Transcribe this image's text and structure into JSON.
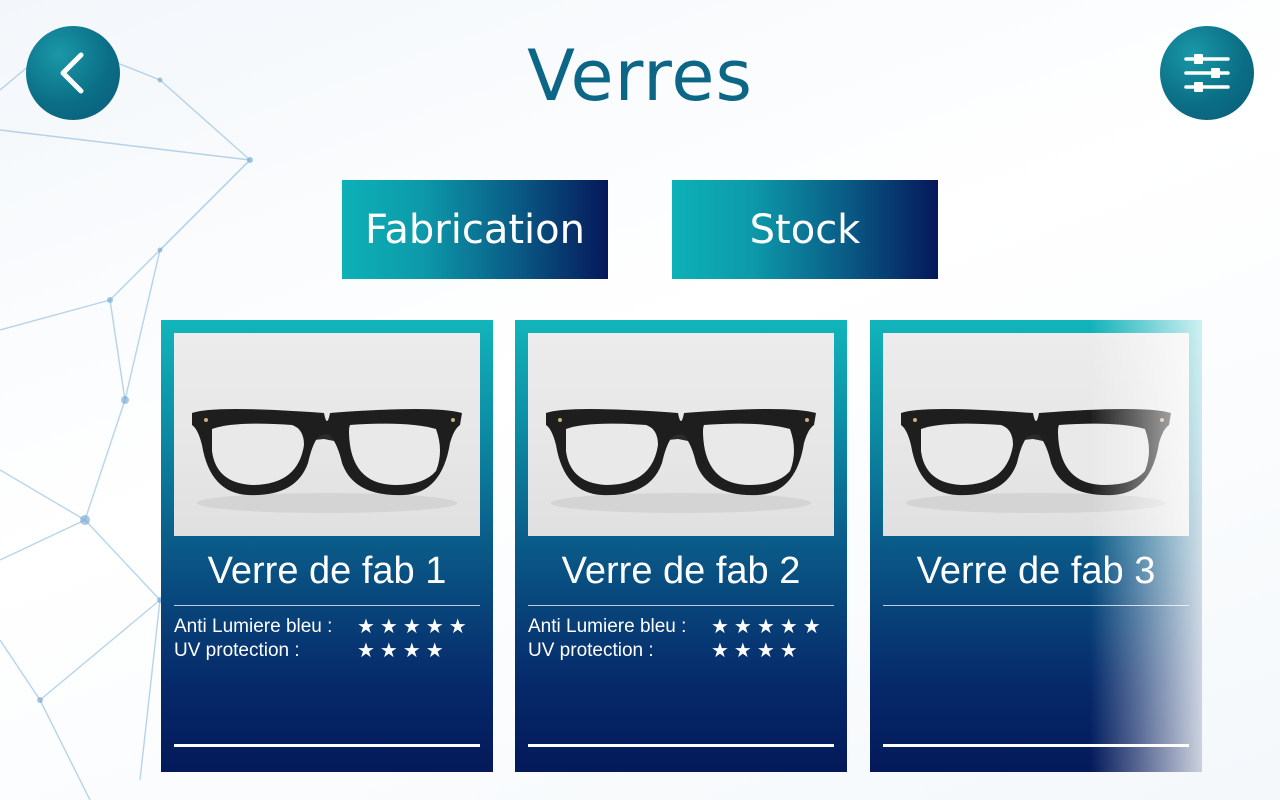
{
  "header": {
    "title": "Verres",
    "back_icon": "chevron-left-icon",
    "filter_icon": "sliders-icon"
  },
  "tabs": [
    {
      "label": "Fabrication"
    },
    {
      "label": "Stock"
    }
  ],
  "cards": [
    {
      "title": "Verre de fab 1",
      "ratings": [
        {
          "label": "Anti Lumiere bleu :",
          "stars": 5,
          "display": "★★★★★"
        },
        {
          "label": "UV protection :",
          "stars": 4,
          "display": "★★★★"
        }
      ]
    },
    {
      "title": "Verre de fab 2",
      "ratings": [
        {
          "label": "Anti Lumiere bleu :",
          "stars": 5,
          "display": "★★★★★"
        },
        {
          "label": "UV protection :",
          "stars": 4,
          "display": "★★★★"
        }
      ]
    },
    {
      "title": "Verre de fab 3",
      "ratings": []
    }
  ],
  "colors": {
    "accent_teal": "#0db1b7",
    "accent_navy": "#06185a",
    "title_color": "#0c6685"
  }
}
